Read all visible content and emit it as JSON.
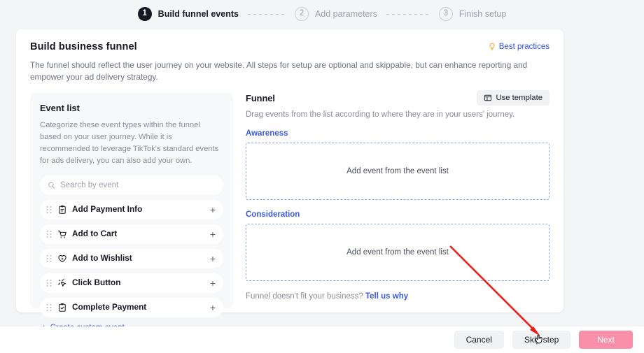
{
  "stepper": {
    "steps": [
      {
        "num": "1",
        "label": "Build funnel events",
        "state": "active"
      },
      {
        "num": "2",
        "label": "Add parameters",
        "state": "idle"
      },
      {
        "num": "3",
        "label": "Finish setup",
        "state": "idle"
      }
    ]
  },
  "card": {
    "title": "Build business funnel",
    "description": "The funnel should reflect the user journey on your website. All steps for setup are optional and skippable, but can enhance reporting and empower your ad delivery strategy.",
    "best_practices_label": "Best practices",
    "best_practices_icon": "lightbulb-icon"
  },
  "event_list": {
    "title": "Event list",
    "description": "Categorize these event types within the funnel based on your user journey. While it is recommended to leverage TikTok's standard events for ads delivery, you can also add your own.",
    "search": {
      "placeholder": "Search by event",
      "value": "",
      "icon": "search-icon"
    },
    "items": [
      {
        "label": "Add Payment Info",
        "icon": "clipboard-icon",
        "add": "+",
        "handle": "drag-handle-icon"
      },
      {
        "label": "Add to Cart",
        "icon": "shopping-cart-icon",
        "add": "+",
        "handle": "drag-handle-icon"
      },
      {
        "label": "Add to Wishlist",
        "icon": "heart-icon",
        "add": "+",
        "handle": "drag-handle-icon"
      },
      {
        "label": "Click Button",
        "icon": "click-cursor-icon",
        "add": "+",
        "handle": "drag-handle-icon"
      },
      {
        "label": "Complete Payment",
        "icon": "clipboard-check-icon",
        "add": "+",
        "handle": "drag-handle-icon"
      }
    ],
    "create_custom_label": "Create custom event",
    "create_custom_plus": "+"
  },
  "funnel": {
    "title": "Funnel",
    "use_template_label": "Use template",
    "use_template_icon": "template-icon",
    "description": "Drag events from the list according to where they are in your users' journey.",
    "stages": [
      {
        "label": "Awareness",
        "placeholder": "Add event from the event list"
      },
      {
        "label": "Consideration",
        "placeholder": "Add event from the event list"
      }
    ],
    "footer_text": "Funnel doesn't fit your business?",
    "footer_link": "Tell us why"
  },
  "footer": {
    "cancel_label": "Cancel",
    "skip_label": "Skip step",
    "next_label": "Next"
  },
  "annotation": {
    "arrow_color": "#e8201c",
    "cursor_icon": "hand-pointer-cursor"
  },
  "colors": {
    "page_bg": "#f4f5f7",
    "card_bg": "#ffffff",
    "panel_bg": "#f7f8fa",
    "accent_blue": "#3b5ae0",
    "link_blue": "#2f50e6",
    "dashed_border": "#8fa4f0",
    "primary_disabled": "#fa8faa",
    "text_dark": "#161823",
    "text_muted": "#8a8d96"
  }
}
